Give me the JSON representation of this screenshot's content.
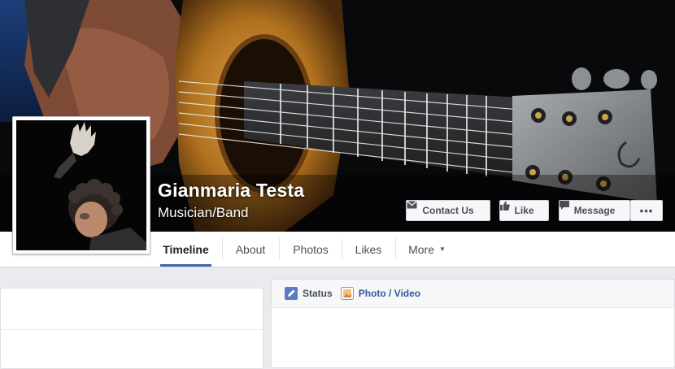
{
  "page": {
    "name": "Gianmaria Testa",
    "category": "Musician/Band"
  },
  "actions": {
    "contact": "Contact Us",
    "like": "Like",
    "message": "Message",
    "more": "•••"
  },
  "tabs": [
    {
      "label": "Timeline",
      "active": true
    },
    {
      "label": "About"
    },
    {
      "label": "Photos"
    },
    {
      "label": "Likes"
    },
    {
      "label": "More"
    }
  ],
  "composer": {
    "status": "Status",
    "photo_video": "Photo / Video"
  },
  "icons": {
    "contact": "envelope-icon",
    "like": "thumbs-up-icon",
    "message": "speech-bubble-icon",
    "status": "pencil-icon",
    "photo": "photo-icon",
    "more_tab": "caret-down-icon"
  },
  "colors": {
    "accent": "#4267b2",
    "link": "#365899",
    "background": "#e9ebee"
  }
}
